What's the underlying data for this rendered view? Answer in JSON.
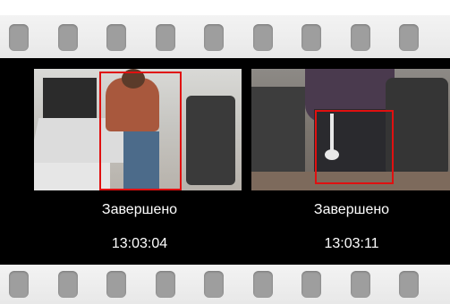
{
  "thumbnails": [
    {
      "status": "Завершено",
      "time": "13:03:04"
    },
    {
      "status": "Завершено",
      "time": "13:03:11"
    }
  ],
  "colors": {
    "film_band": "#000000",
    "perforation": "#9e9e9e",
    "perforation_strip": "#eeeeee",
    "detection_box": "#e01010",
    "caption_text": "#ffffff"
  },
  "icons": [
    "detection-box"
  ]
}
